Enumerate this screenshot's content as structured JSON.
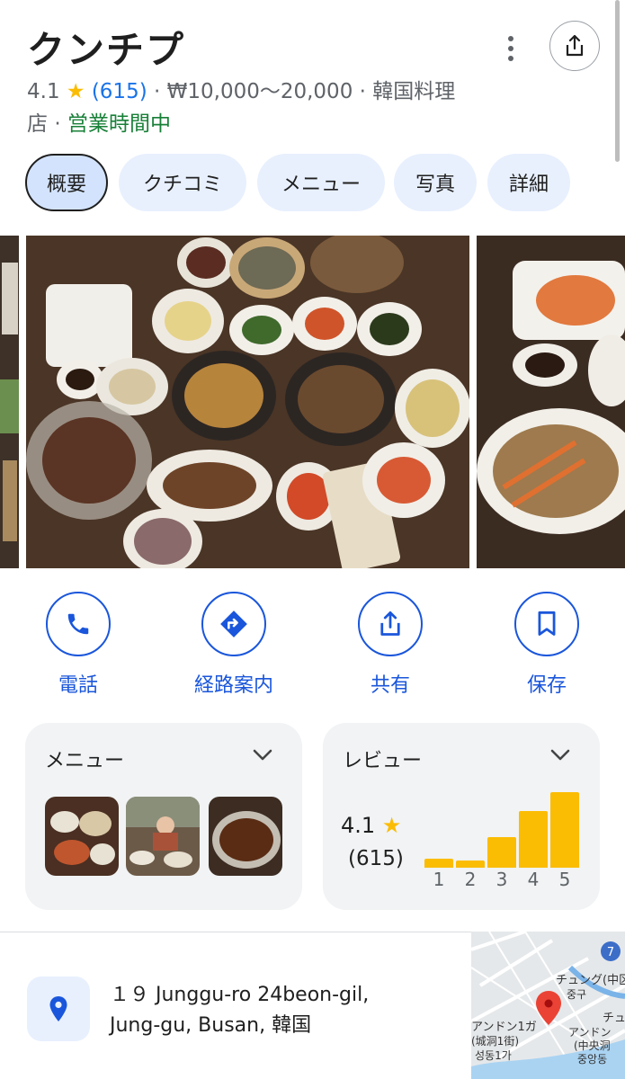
{
  "place": {
    "name": "クンチプ",
    "rating": "4.1",
    "star": "★",
    "review_count": "(615)",
    "sep": "·",
    "price": "₩10,000～20,000",
    "category_a": "韓国料理",
    "category_b": "店",
    "status": "営業時間中"
  },
  "tabs": [
    "概要",
    "クチコミ",
    "メニュー",
    "写真",
    "詳細"
  ],
  "actions": {
    "call": "電話",
    "directions": "経路案内",
    "share": "共有",
    "save": "保存"
  },
  "cards": {
    "menu_title": "メニュー",
    "review_title": "レビュー",
    "rating": "4.1",
    "star": "★",
    "count": "(615)",
    "histogram": {
      "labels": [
        "1",
        "2",
        "3",
        "4",
        "5"
      ],
      "values": [
        0.12,
        0.1,
        0.4,
        0.75,
        1.0
      ]
    }
  },
  "address": {
    "line1": "１９ Junggu-ro 24beon-gil,",
    "line2": "Jung-gu, Busan, 韓国"
  },
  "map": {
    "route_badge": "7",
    "label_1": "チュング(中区",
    "label_2": "중구",
    "label_3": "アンドン1ガ",
    "label_4": "(城洞1街)",
    "label_5": "성동1가",
    "label_6": "チュ",
    "label_7": "アンドン",
    "label_8": "(中央洞",
    "label_9": "중앙동"
  },
  "colors": {
    "accent": "#1a56db",
    "star": "#fbbc04",
    "open": "#188038",
    "tab_bg": "#e8f0fe"
  }
}
